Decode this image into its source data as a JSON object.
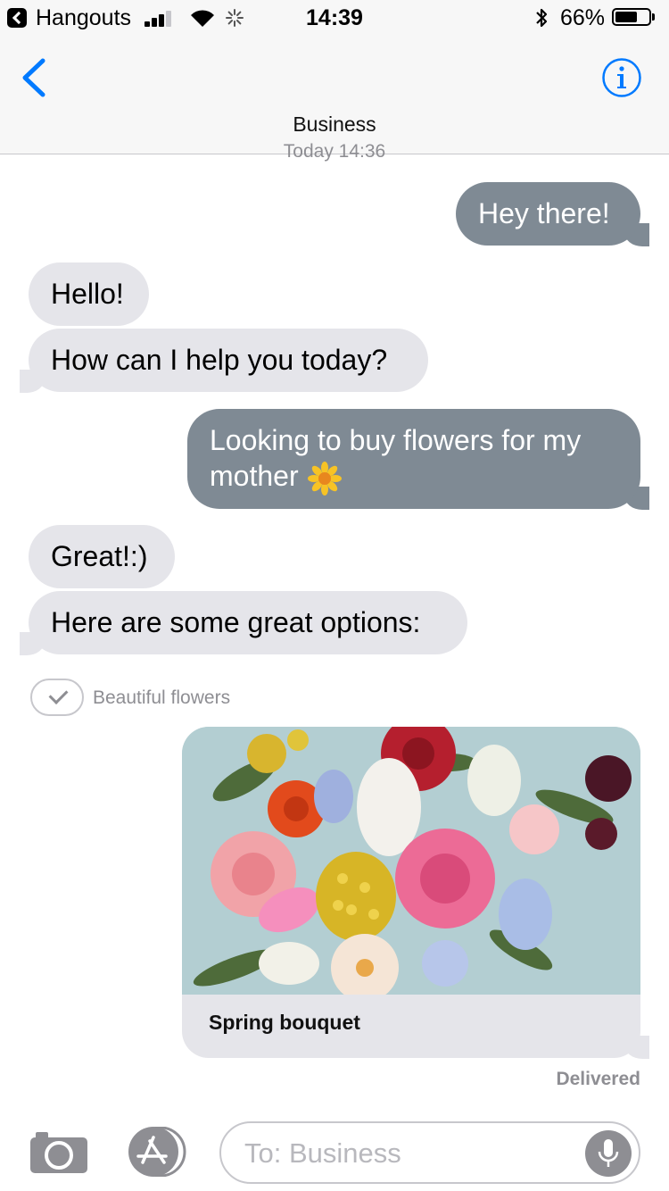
{
  "status_bar": {
    "back_app": "Hangouts",
    "time": "14:39",
    "battery_pct": "66%",
    "battery_level": 0.66,
    "icons": [
      "back-app-icon",
      "signal-icon",
      "wifi-icon",
      "activity-spinner-icon",
      "bluetooth-icon",
      "battery-icon"
    ]
  },
  "nav": {
    "title": "Business",
    "icons": [
      "chevron-left-icon",
      "info-icon"
    ],
    "accent": "#007aff"
  },
  "timestamp": "Today 14:36",
  "messages": [
    {
      "from": "me",
      "text": "Hey there!"
    },
    {
      "from": "them",
      "text": "Hello!"
    },
    {
      "from": "them",
      "text": "How can I help you today?"
    },
    {
      "from": "me",
      "text": "Looking to buy flowers for my mother",
      "emoji": "sunflower-emoji"
    },
    {
      "from": "them",
      "text": "Great!:)"
    },
    {
      "from": "them",
      "text": "Here are some great options:"
    }
  ],
  "colors": {
    "outgoing_bubble": "#7f8a94",
    "incoming_bubble": "#e5e5ea"
  },
  "selection": {
    "label": "Beautiful flowers",
    "icon": "checkmark-icon"
  },
  "card": {
    "caption": "Spring bouquet",
    "image": "flower-bouquet-photo"
  },
  "delivered": "Delivered",
  "composer": {
    "placeholder": "To: Business",
    "icons": [
      "camera-icon",
      "app-store-icon",
      "microphone-icon"
    ]
  }
}
